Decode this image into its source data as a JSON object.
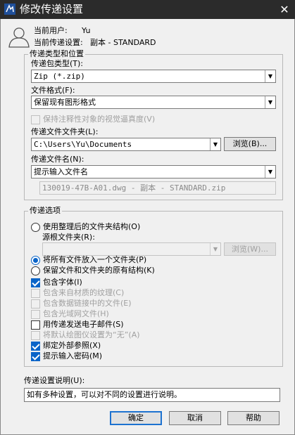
{
  "window": {
    "title": "修改传递设置",
    "close_glyph": "✕"
  },
  "user": {
    "current_user_label": "当前用户:",
    "current_user_value": "Yu",
    "current_setup_label": "当前传递设置:",
    "current_setup_value": "副本 - STANDARD"
  },
  "package_group": {
    "title": "传递类型和位置",
    "package_type_label": "传递包类型(T):",
    "package_type_value": "Zip (*.zip)",
    "file_format_label": "文件格式(F):",
    "file_format_value": "保留现有图形格式",
    "maintain_visual_fidelity_label": "保持注释性对象的视觉逼真度(V)",
    "maintain_visual_fidelity_checked": false,
    "folder_label": "传递文件文件夹(L):",
    "folder_value": "C:\\Users\\Yu\\Documents",
    "browse_label": "浏览(B)...",
    "filename_label": "传递文件名(N):",
    "filename_value": "提示输入文件名",
    "preview_value": "130019-47B-A01.dwg - 副本 - STANDARD.zip"
  },
  "options_group": {
    "title": "传递选项",
    "organized_folder_label": "使用整理后的文件夹结构(O)",
    "organized_folder_selected": false,
    "source_root_label": "源根文件夹(R):",
    "source_root_value": "",
    "source_browse_label": "浏览(W)...",
    "single_folder_label": "将所有文件放入一个文件夹(P)",
    "single_folder_selected": true,
    "keep_structure_label": "保留文件和文件夹的原有结构(K)",
    "keep_structure_selected": false,
    "checks": [
      {
        "label": "包含字体(I)",
        "checked": true,
        "disabled": false
      },
      {
        "label": "包含来自材质的纹理(C)",
        "checked": false,
        "disabled": true
      },
      {
        "label": "包含数据链接中的文件(E)",
        "checked": false,
        "disabled": true
      },
      {
        "label": "包含光域网文件(H)",
        "checked": false,
        "disabled": true
      },
      {
        "label": "用传递发送电子邮件(S)",
        "checked": false,
        "disabled": false
      },
      {
        "label": "将默认绘图仪设置为“无”(A)",
        "checked": false,
        "disabled": true
      },
      {
        "label": "绑定外部参照(X)",
        "checked": true,
        "disabled": false
      },
      {
        "label": "提示输入密码(M)",
        "checked": true,
        "disabled": false
      }
    ]
  },
  "description": {
    "label": "传递设置说明(U):",
    "value": "如有多种设置，可以对不同的设置进行说明。"
  },
  "buttons": {
    "ok": "确定",
    "cancel": "取消",
    "help": "帮助"
  },
  "colors": {
    "titlebar": "#2b2b2b",
    "accent": "#0a64c8",
    "default_button_border": "#1d72d0"
  }
}
